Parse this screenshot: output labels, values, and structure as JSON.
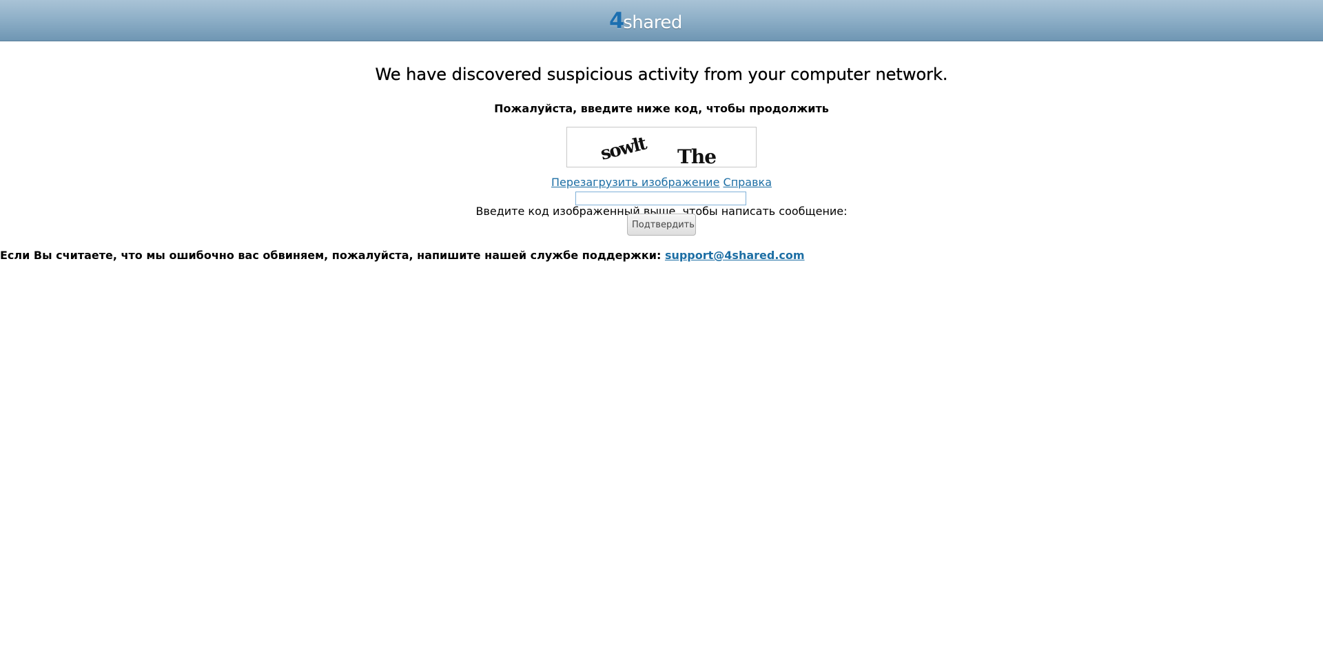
{
  "brand": {
    "logo_four": "4",
    "logo_text": "shared"
  },
  "headline": "We have discovered suspicious activity from your computer network.",
  "subhead": "Пожалуйста, введите ниже код, чтобы продолжить",
  "captcha": {
    "text_left": "sowlt",
    "text_right": "The"
  },
  "links": {
    "reload_label": "Перезагрузить изображение",
    "help_label": "Справка"
  },
  "instruction": "Введите код изображенный выше, чтобы написать сообщение:",
  "input": {
    "value": ""
  },
  "submit_label": "Подтвердить",
  "footer": {
    "text": "Если Вы считаете, что мы ошибочно вас обвиняем, пожалуйста, напишите нашей службе поддержки:",
    "email": "support@4shared.com"
  },
  "colors": {
    "link": "#1c6ea4",
    "header_top": "#a9c3d6",
    "header_bottom": "#6f96b3"
  }
}
